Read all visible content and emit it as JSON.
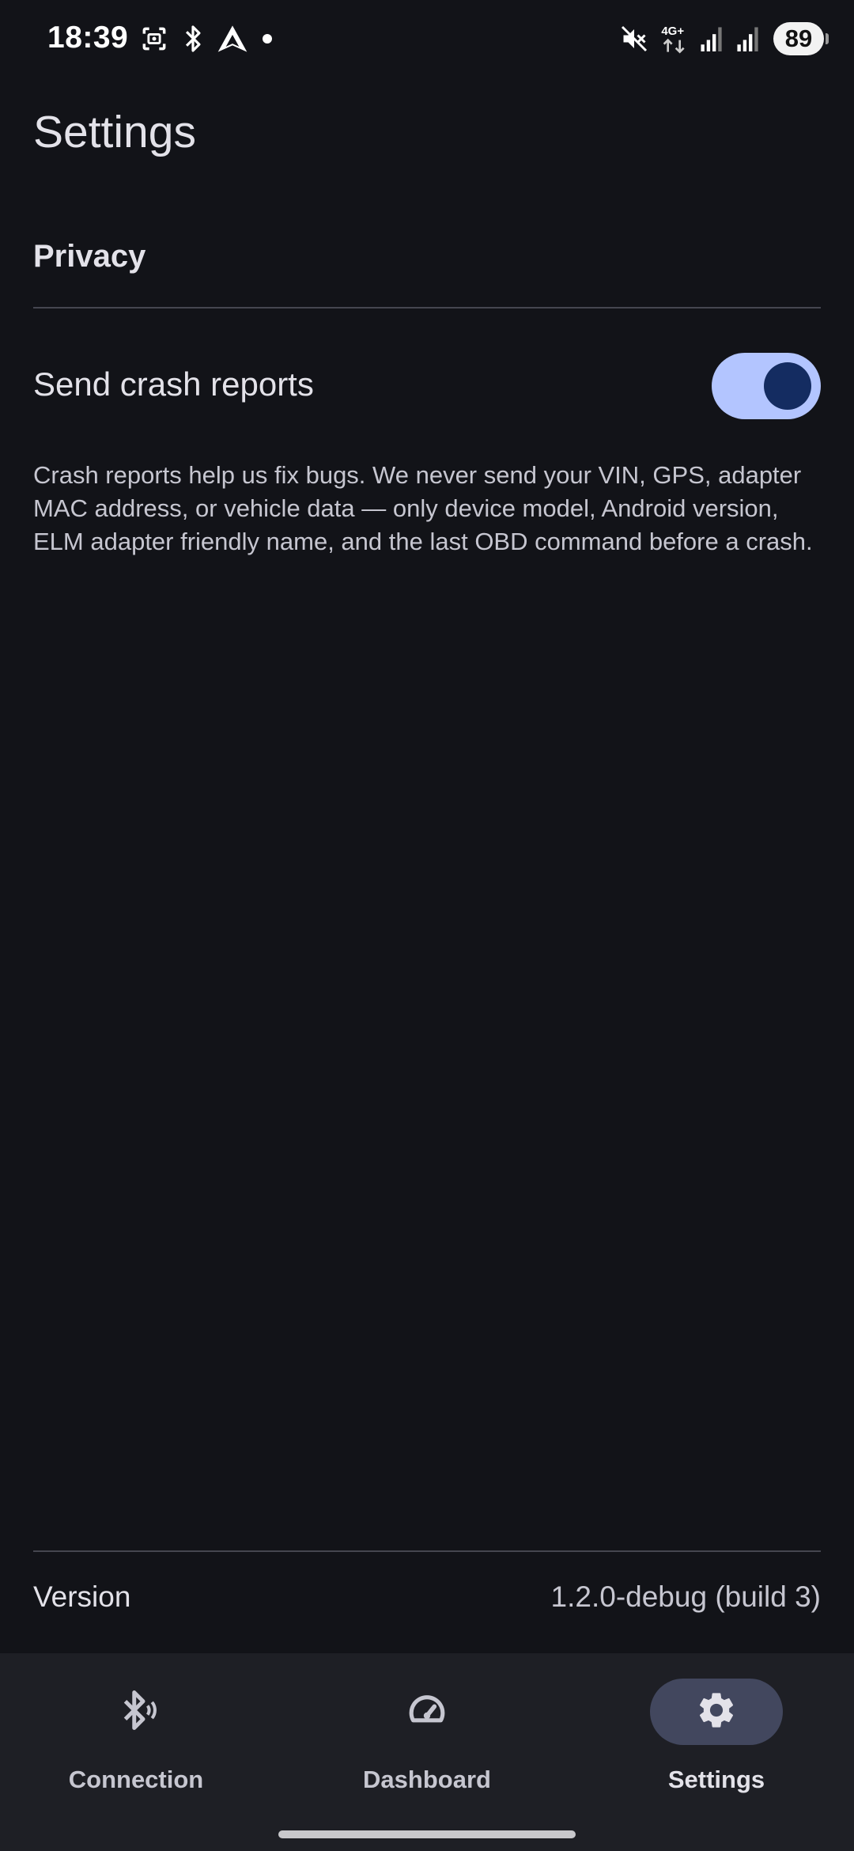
{
  "status_bar": {
    "time": "18:39",
    "battery": "89",
    "network": "4G+",
    "icons": [
      "screenshot-icon",
      "bluetooth-icon",
      "android-auto-icon",
      "notification-dot-icon",
      "mute-icon",
      "mobile-data-icon",
      "signal-icon",
      "signal-icon-2"
    ]
  },
  "header": {
    "title": "Settings"
  },
  "privacy": {
    "section_title": "Privacy",
    "crash_reports_label": "Send crash reports",
    "crash_reports_enabled": true,
    "description": "Crash reports help us fix bugs. We never send your VIN, GPS, adapter MAC address, or vehicle data — only device model, Android version, ELM adapter friendly name, and the last OBD command before a crash."
  },
  "version": {
    "label": "Version",
    "value": "1.2.0-debug (build 3)"
  },
  "bottom_nav": {
    "items": [
      {
        "label": "Connection",
        "icon": "bluetooth-connect-icon",
        "active": false
      },
      {
        "label": "Dashboard",
        "icon": "speedometer-icon",
        "active": false
      },
      {
        "label": "Settings",
        "icon": "gear-icon",
        "active": true
      }
    ]
  },
  "colors": {
    "background": "#121318",
    "nav_background": "#1E1F25",
    "toggle_track": "#B3C5FF",
    "toggle_thumb": "#142C61",
    "active_indicator": "#42475E"
  }
}
